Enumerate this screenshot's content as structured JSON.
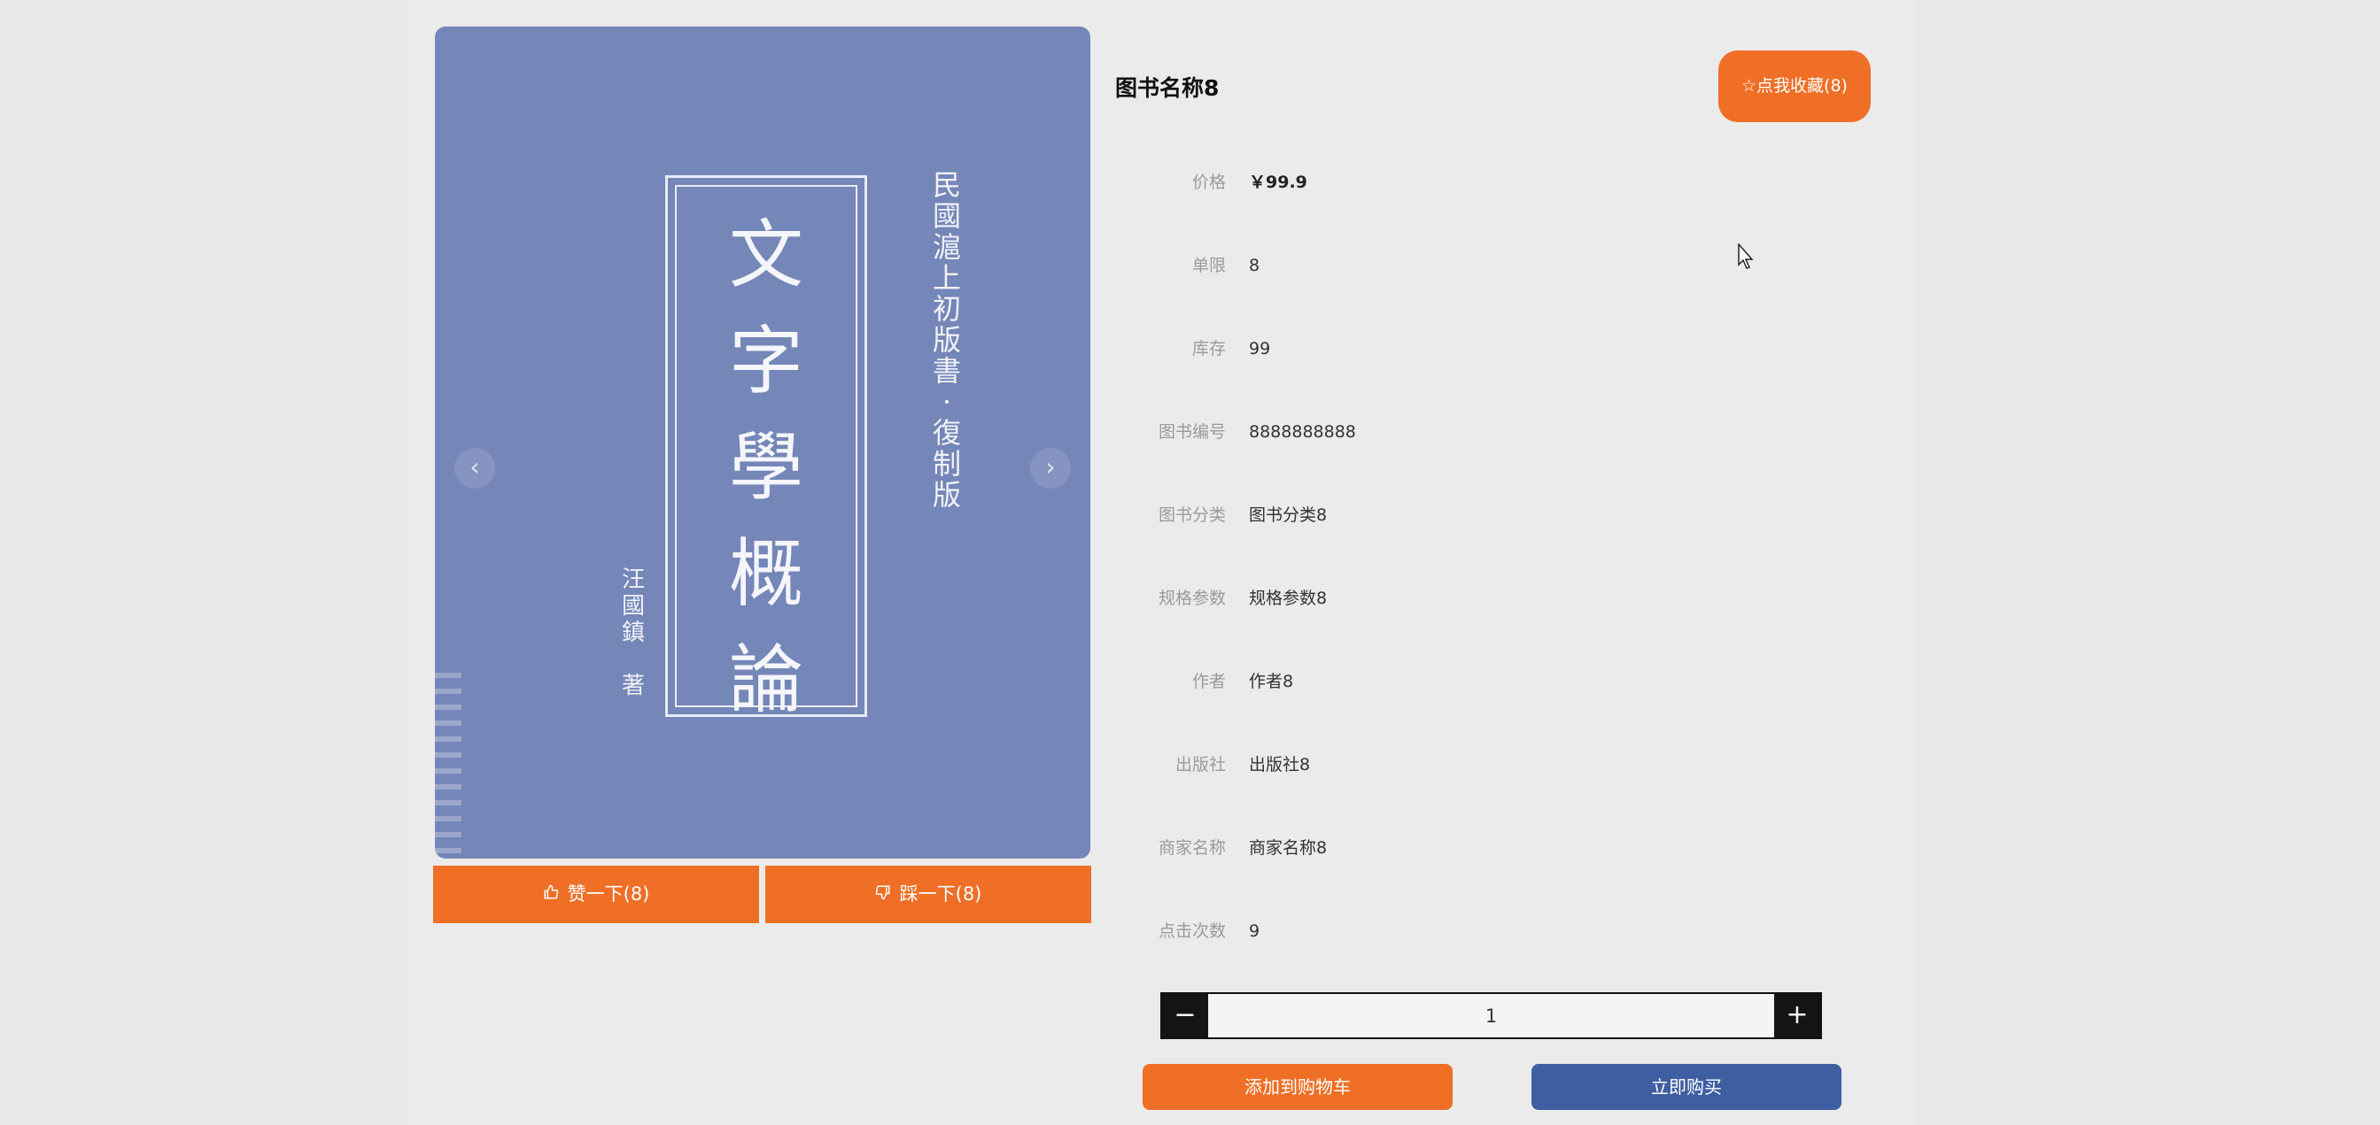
{
  "cover": {
    "title_chars": [
      "文",
      "字",
      "學",
      "概",
      "論"
    ],
    "subtitle_chars": [
      "民",
      "國",
      "滬",
      "上",
      "初",
      "版",
      "書",
      "·",
      "復",
      "制",
      "版"
    ],
    "author_chars": [
      "汪",
      "國",
      "鎮",
      "",
      "著"
    ],
    "prev_glyph": "‹",
    "next_glyph": "›"
  },
  "votes": {
    "like_label": "赞一下(8)",
    "like_icon": "thumbs-up-icon",
    "dislike_label": "踩一下(8)",
    "dislike_icon": "thumbs-down-icon"
  },
  "book": {
    "title": "图书名称8",
    "favorite_label": "☆点我收藏(8)",
    "details": [
      {
        "label": "价格",
        "value": "￥99.9"
      },
      {
        "label": "单限",
        "value": "8"
      },
      {
        "label": "库存",
        "value": "99"
      },
      {
        "label": "图书编号",
        "value": "8888888888"
      },
      {
        "label": "图书分类",
        "value": "图书分类8"
      },
      {
        "label": "规格参数",
        "value": "规格参数8"
      },
      {
        "label": "作者",
        "value": "作者8"
      },
      {
        "label": "出版社",
        "value": "出版社8"
      },
      {
        "label": "商家名称",
        "value": "商家名称8"
      },
      {
        "label": "点击次数",
        "value": "9"
      }
    ]
  },
  "quantity": {
    "minus": "−",
    "plus": "+",
    "value": "1"
  },
  "actions": {
    "add_to_cart": "添加到购物车",
    "buy_now": "立即购买"
  },
  "colors": {
    "accent_orange": "#ef6f26",
    "primary_blue": "#3f5ea2",
    "cover_blue": "#7586b8"
  }
}
